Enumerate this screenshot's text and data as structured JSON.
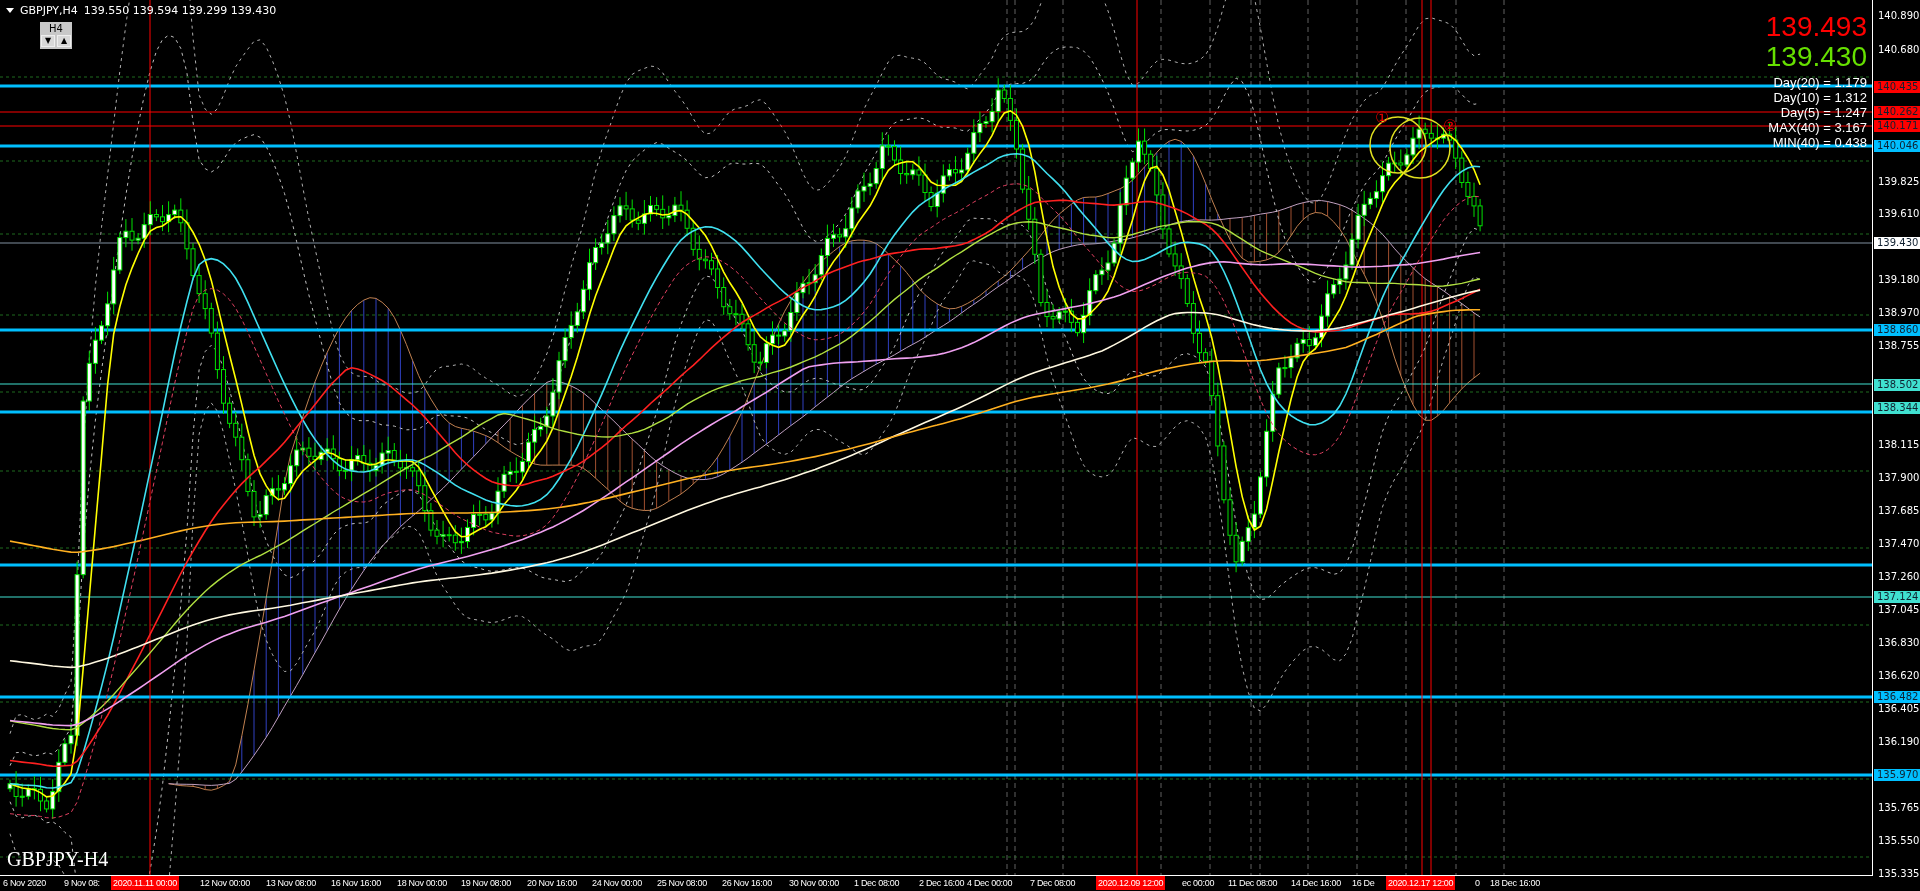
{
  "symbol_header": {
    "title": "GBPJPY,H4",
    "ohlc": "139.550 139.594 139.299 139.430"
  },
  "timeframe_box": {
    "label": "H4",
    "down": "▼",
    "up": "▲"
  },
  "price_display": {
    "bid": "139.493",
    "last": "139.430"
  },
  "stats": [
    "Day(20) = 1.179",
    "Day(10) = 1.312",
    "Day(5) = 1.247",
    "MAX(40) = 3.167",
    "MIN(40) = 0.438"
  ],
  "markers": [
    "①",
    "②"
  ],
  "chart_label": "GBPJPY-H4",
  "price_axis": [
    {
      "kind": "tick",
      "text": "140.890"
    },
    {
      "kind": "tick",
      "text": "140.680"
    },
    {
      "kind": "badge",
      "text": "140.435",
      "color": "#ff0000"
    },
    {
      "kind": "badge",
      "text": "140.262",
      "color": "#ff0000"
    },
    {
      "kind": "badge",
      "text": "140.171",
      "color": "#ff0000"
    },
    {
      "kind": "badge",
      "text": "140.046",
      "color": "#00bfff"
    },
    {
      "kind": "tick",
      "text": "139.825"
    },
    {
      "kind": "tick",
      "text": "139.610"
    },
    {
      "kind": "badge",
      "text": "139.430",
      "color": "#ffffff"
    },
    {
      "kind": "tick",
      "text": "139.180"
    },
    {
      "kind": "tick",
      "text": "138.970"
    },
    {
      "kind": "badge",
      "text": "138.860",
      "color": "#00bfff"
    },
    {
      "kind": "tick",
      "text": "138.755"
    },
    {
      "kind": "badge",
      "text": "138.502",
      "color": "#40e0d0"
    },
    {
      "kind": "badge",
      "text": "138.344",
      "color": "#40e0d0"
    },
    {
      "kind": "tick",
      "text": "138.115"
    },
    {
      "kind": "tick",
      "text": "137.900"
    },
    {
      "kind": "tick",
      "text": "137.685"
    },
    {
      "kind": "tick",
      "text": "137.470"
    },
    {
      "kind": "tick",
      "text": "137.260"
    },
    {
      "kind": "badge",
      "text": "137.124",
      "color": "#40e0d0"
    },
    {
      "kind": "tick",
      "text": "137.045"
    },
    {
      "kind": "tick",
      "text": "136.830"
    },
    {
      "kind": "tick",
      "text": "136.620"
    },
    {
      "kind": "badge",
      "text": "136.482",
      "color": "#00bfff"
    },
    {
      "kind": "tick",
      "text": "136.405"
    },
    {
      "kind": "tick",
      "text": "136.190"
    },
    {
      "kind": "badge",
      "text": "135.970",
      "color": "#00bfff"
    },
    {
      "kind": "tick",
      "text": "135.765"
    },
    {
      "kind": "tick",
      "text": "135.550"
    },
    {
      "kind": "tick",
      "text": "135.335"
    }
  ],
  "time_axis": [
    {
      "kind": "tick",
      "text": "6 Nov 2020"
    },
    {
      "kind": "tick",
      "text": "9 Nov 08:"
    },
    {
      "kind": "badge",
      "text": "2020.11.11 00:00"
    },
    {
      "kind": "tick",
      "text": "12 Nov 00:00"
    },
    {
      "kind": "tick",
      "text": "13 Nov 08:00"
    },
    {
      "kind": "tick",
      "text": "16 Nov 16:00"
    },
    {
      "kind": "tick",
      "text": "18 Nov 00:00"
    },
    {
      "kind": "tick",
      "text": "19 Nov 08:00"
    },
    {
      "kind": "tick",
      "text": "20 Nov 16:00"
    },
    {
      "kind": "tick",
      "text": "24 Nov 00:00"
    },
    {
      "kind": "tick",
      "text": "25 Nov 08:00"
    },
    {
      "kind": "tick",
      "text": "26 Nov 16:00"
    },
    {
      "kind": "tick",
      "text": "30 Nov 00:00"
    },
    {
      "kind": "tick",
      "text": "1 Dec 08:00"
    },
    {
      "kind": "tick",
      "text": "2 Dec 16:00"
    },
    {
      "kind": "tick",
      "text": "4 Dec 00:00"
    },
    {
      "kind": "tick",
      "text": "7 Dec 08:00"
    },
    {
      "kind": "badge",
      "text": "2020.12.09 12:00"
    },
    {
      "kind": "tick",
      "text": "ec 00:00"
    },
    {
      "kind": "tick",
      "text": "11 Dec 08:00"
    },
    {
      "kind": "tick",
      "text": "14 Dec 16:00"
    },
    {
      "kind": "tick",
      "text": "16 De"
    },
    {
      "kind": "badge",
      "text": "2020.12.17 12:00"
    },
    {
      "kind": "tick",
      "text": "0"
    },
    {
      "kind": "tick",
      "text": "18 Dec 16:00"
    }
  ]
}
